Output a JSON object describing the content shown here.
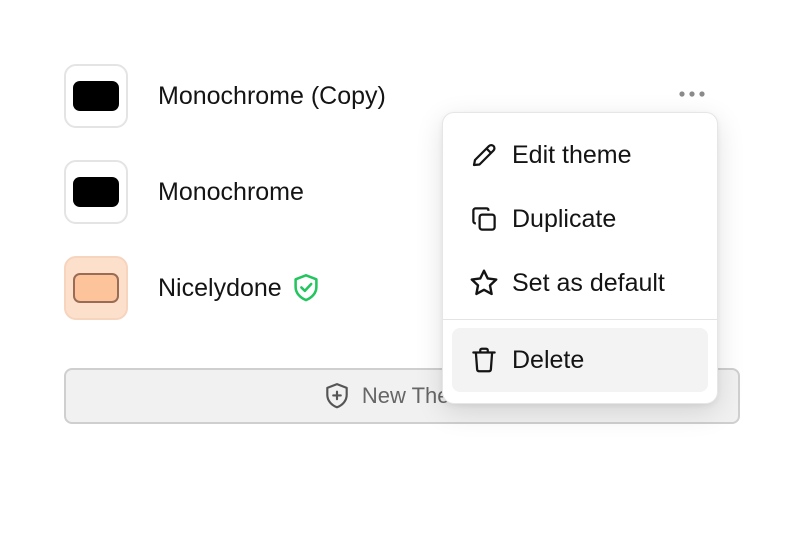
{
  "themes": [
    {
      "name": "Monochrome (Copy)",
      "swatch_fill": "#000000",
      "swatch_bg": "#ffffff",
      "swatch_border": "#000000"
    },
    {
      "name": "Monochrome",
      "swatch_fill": "#000000",
      "swatch_bg": "#ffffff",
      "swatch_border": "#000000"
    },
    {
      "name": "Nicelydone",
      "swatch_fill": "#fdc39b",
      "swatch_bg": "#fde0cc",
      "swatch_border": "#9a6b55",
      "verified": true
    }
  ],
  "new_theme_button": {
    "label": "New Theme"
  },
  "context_menu": {
    "items": [
      {
        "label": "Edit theme",
        "icon": "pencil-icon"
      },
      {
        "label": "Duplicate",
        "icon": "copy-icon"
      },
      {
        "label": "Set as default",
        "icon": "star-icon"
      },
      {
        "label": "Delete",
        "icon": "trash-icon"
      }
    ]
  },
  "colors": {
    "verified_green": "#22c55e",
    "menu_hover": "#f3f3f3"
  }
}
